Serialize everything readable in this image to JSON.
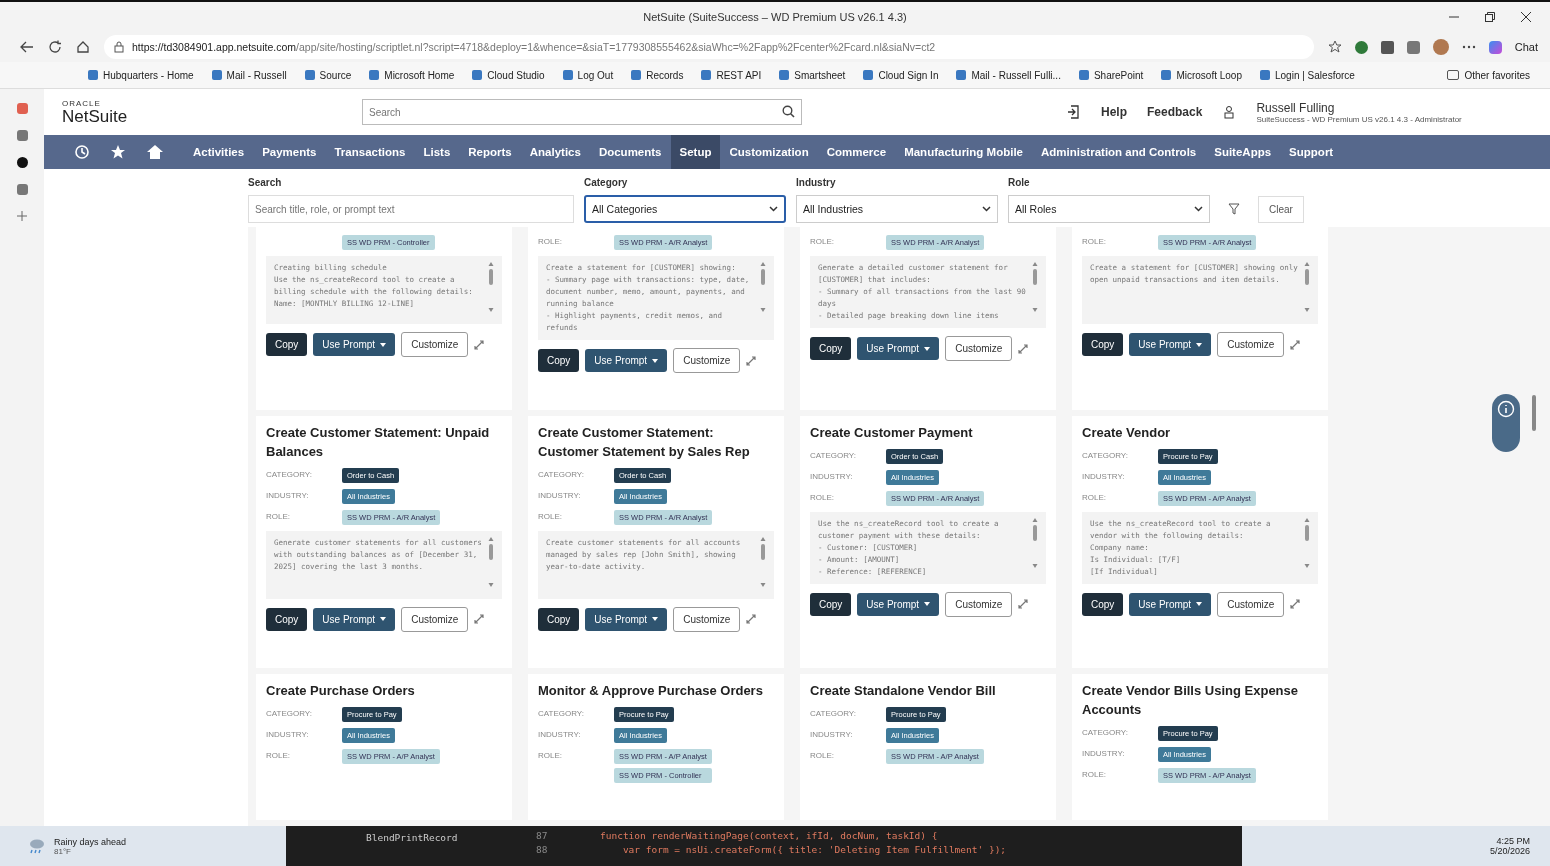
{
  "browser": {
    "title": "NetSuite (SuiteSuccess – WD Premium US v26.1 4.3)",
    "url_host": "https://td3084901.app.netsuite.com",
    "url_path": "/app/site/hosting/scriptlet.nl?script=4718&deploy=1&whence=&siaT=1779308555462&siaWhc=%2Fapp%2Fcenter%2Fcard.nl&siaNv=ct2",
    "chat": "Chat",
    "bookmarks": [
      "Hubquarters - Home",
      "Mail - Russell",
      "Source",
      "Microsoft Home",
      "Cloud Studio",
      "Log Out",
      "Records",
      "REST API",
      "Smartsheet",
      "Cloud Sign In",
      "Mail - Russell Fulli...",
      "SharePoint",
      "Microsoft Loop",
      "Login | Salesforce"
    ],
    "other_favorites": "Other favorites"
  },
  "header": {
    "logo_top": "ORACLE",
    "logo": "NetSuite",
    "search": {
      "placeholder": "Search"
    },
    "help": "Help",
    "feedback": "Feedback",
    "user": "Russell Fulling",
    "account": "SuiteSuccess - WD Premium US v26.1 4.3 - Administrator"
  },
  "nav": [
    {
      "label": "Activities",
      "selected": false
    },
    {
      "label": "Payments",
      "selected": false
    },
    {
      "label": "Transactions",
      "selected": false
    },
    {
      "label": "Lists",
      "selected": false
    },
    {
      "label": "Reports",
      "selected": false
    },
    {
      "label": "Analytics",
      "selected": false
    },
    {
      "label": "Documents",
      "selected": false
    },
    {
      "label": "Setup",
      "selected": true
    },
    {
      "label": "Customization",
      "selected": false
    },
    {
      "label": "Commerce",
      "selected": false
    },
    {
      "label": "Manufacturing Mobile",
      "selected": false
    },
    {
      "label": "Administration and Controls",
      "selected": false
    },
    {
      "label": "SuiteApps",
      "selected": false
    },
    {
      "label": "Support",
      "selected": false
    }
  ],
  "filters": {
    "search_label": "Search",
    "search": {
      "placeholder": "Search title, role, or prompt text"
    },
    "category_label": "Category",
    "category": "All Categories",
    "industry_label": "Industry",
    "industry": "All Industries",
    "role_label": "Role",
    "role": "All Roles",
    "clear": "Clear"
  },
  "card_rows": [
    [
      {
        "roles": [
          "SS WD PRM - Controller"
        ],
        "prompt": "Creating billing schedule\nUse the ns_createRecord tool to create a billing schedule with the following details:\nName: [MONTHLY BILLING 12-LINE]",
        "copy": "Copy",
        "use_prompt": "Use Prompt",
        "customize": "Customize"
      },
      {
        "role_label": "ROLE:",
        "roles": [
          "SS WD PRM - A/R Analyst"
        ],
        "prompt": "Create a statement for [CUSTOMER] showing:\n- Summary page with transactions: type, date, document number, memo, amount, payments, and running balance\n- Highlight payments, credit memos, and refunds",
        "copy": "Copy",
        "use_prompt": "Use Prompt",
        "customize": "Customize"
      },
      {
        "role_label": "ROLE:",
        "roles": [
          "SS WD PRM - A/R Analyst"
        ],
        "prompt": "Generate a detailed customer statement for [CUSTOMER] that includes:\n- Summary of all transactions from the last 90 days\n- Detailed page breaking down line items",
        "copy": "Copy",
        "use_prompt": "Use Prompt",
        "customize": "Customize"
      },
      {
        "role_label": "ROLE:",
        "roles": [
          "SS WD PRM - A/R Analyst"
        ],
        "prompt": "Create a statement for [CUSTOMER] showing only open unpaid transactions and item details.",
        "copy": "Copy",
        "use_prompt": "Use Prompt",
        "customize": "Customize"
      }
    ],
    [
      {
        "title": "Create Customer Statement: Unpaid Balances",
        "category_label": "CATEGORY:",
        "category": "Order to Cash",
        "industry_label": "INDUSTRY:",
        "industry": "All Industries",
        "role_label": "ROLE:",
        "roles": [
          "SS WD PRM - A/R Analyst"
        ],
        "prompt": "Generate customer statements for all customers with outstanding balances as of [December 31, 2025] covering the last 3 months.",
        "copy": "Copy",
        "use_prompt": "Use Prompt",
        "customize": "Customize"
      },
      {
        "title": "Create Customer Statement: Customer Statement by Sales Rep",
        "category_label": "CATEGORY:",
        "category": "Order to Cash",
        "industry_label": "INDUSTRY:",
        "industry": "All Industries",
        "role_label": "ROLE:",
        "roles": [
          "SS WD PRM - A/R Analyst"
        ],
        "prompt": "Create customer statements for all accounts managed by sales rep [John Smith], showing year-to-date activity.",
        "copy": "Copy",
        "use_prompt": "Use Prompt",
        "customize": "Customize"
      },
      {
        "title": "Create Customer Payment",
        "category_label": "CATEGORY:",
        "category": "Order to Cash",
        "industry_label": "INDUSTRY:",
        "industry": "All Industries",
        "role_label": "ROLE:",
        "roles": [
          "SS WD PRM - A/R Analyst"
        ],
        "prompt": "Use the ns_createRecord tool to create a customer payment with these details:\n- Customer: [CUSTOMER]\n- Amount: [AMOUNT]\n- Reference: [REFERENCE]",
        "copy": "Copy",
        "use_prompt": "Use Prompt",
        "customize": "Customize"
      },
      {
        "title": "Create Vendor",
        "category_label": "CATEGORY:",
        "category": "Procure to Pay",
        "industry_label": "INDUSTRY:",
        "industry": "All Industries",
        "role_label": "ROLE:",
        "roles": [
          "SS WD PRM - A/P Analyst"
        ],
        "prompt": "Use the ns_createRecord tool to create a vendor with the following details:\nCompany name:\nIs Individual: [T/F]\n[If Individual]",
        "copy": "Copy",
        "use_prompt": "Use Prompt",
        "customize": "Customize"
      }
    ],
    [
      {
        "title": "Create Purchase Orders",
        "category_label": "CATEGORY:",
        "category": "Procure to Pay",
        "industry_label": "INDUSTRY:",
        "industry": "All Industries",
        "role_label": "ROLE:",
        "roles": [
          "SS WD PRM - A/P Analyst"
        ]
      },
      {
        "title": "Monitor & Approve Purchase Orders",
        "category_label": "CATEGORY:",
        "category": "Procure to Pay",
        "industry_label": "INDUSTRY:",
        "industry": "All Industries",
        "role_label": "ROLE:",
        "roles": [
          "SS WD PRM - A/P Analyst",
          "SS WD PRM - Controller"
        ]
      },
      {
        "title": "Create Standalone Vendor Bill",
        "category_label": "CATEGORY:",
        "category": "Procure to Pay",
        "industry_label": "INDUSTRY:",
        "industry": "All Industries",
        "role_label": "ROLE:",
        "roles": [
          "SS WD PRM - A/P Analyst"
        ]
      },
      {
        "title": "Create Vendor Bills Using Expense Accounts",
        "category_label": "CATEGORY:",
        "category": "Procure to Pay",
        "industry_label": "INDUSTRY:",
        "industry": "All Industries",
        "role_label": "ROLE:",
        "roles": [
          "SS WD PRM - A/P Analyst"
        ]
      }
    ]
  ],
  "taskbar": {
    "weather": "Rainy days ahead",
    "temperature": "81°F",
    "editor_files": [
      "BlendPrintRecord"
    ],
    "code": [
      {
        "line": "87",
        "text": "function renderWaitingPage(context, ifId, docNum, taskId) {"
      },
      {
        "line": "88",
        "text": "    var form = nsUi.createForm({ title: 'Deleting Item Fulfillment' });"
      }
    ],
    "time": "4:25 PM",
    "date": "5/20/2026"
  }
}
